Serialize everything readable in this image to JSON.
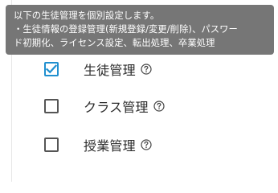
{
  "tooltip": {
    "line1": "以下の生徒管理を個別設定します。",
    "line2": "・生徒情報の登録管理(新規登録/変更/削除)、パスワー",
    "line3": "ド初期化、ライセンス設定、転出処理、卒業処理"
  },
  "options": [
    {
      "label": "生徒管理",
      "checked": true
    },
    {
      "label": "クラス管理",
      "checked": false
    },
    {
      "label": "授業管理",
      "checked": false
    }
  ],
  "colors": {
    "accent": "#1f8fcf",
    "tooltip_bg": "#767676"
  },
  "icons": {
    "help": "question-circle-icon",
    "check": "checkmark-icon"
  }
}
